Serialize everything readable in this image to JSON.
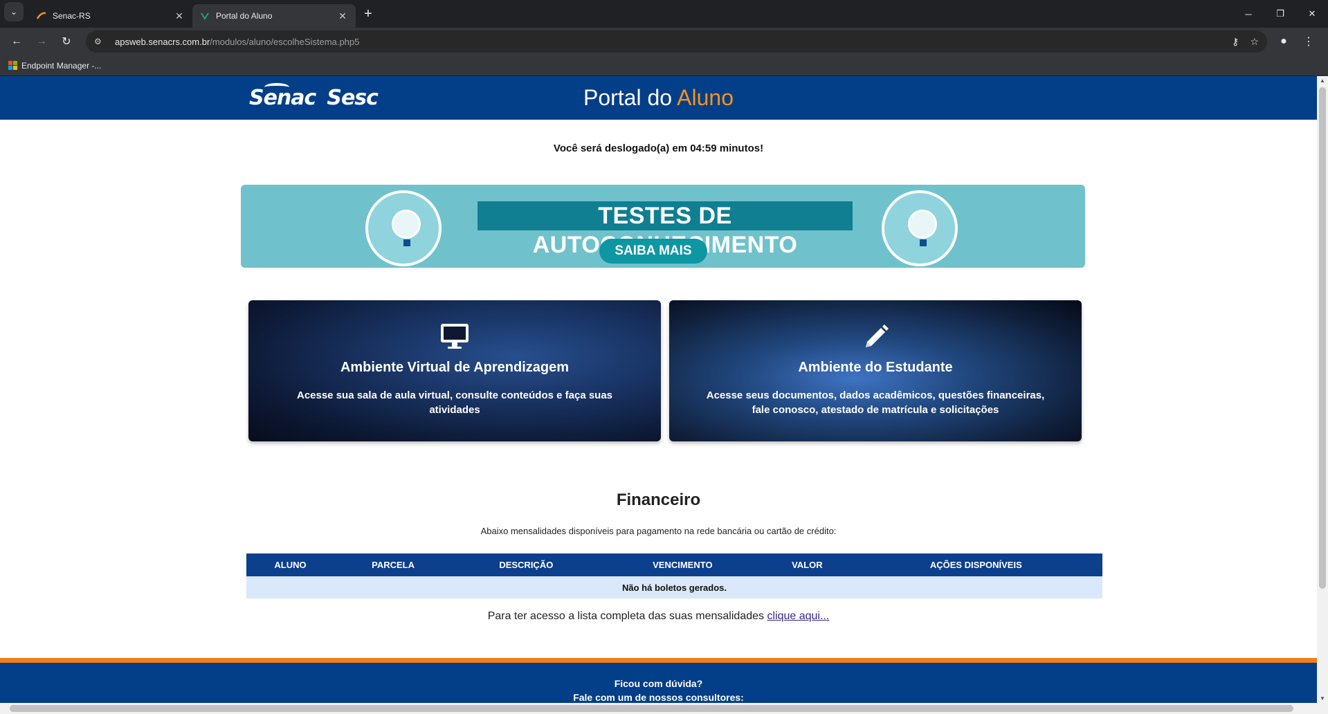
{
  "browser": {
    "tabs": [
      {
        "title": "Senac-RS",
        "active": false
      },
      {
        "title": "Portal do Aluno",
        "active": true
      }
    ],
    "url_host": "apsweb.senacrs.com.br",
    "url_path": "/modulos/aluno/escolheSistema.php5",
    "bookmark": "Endpoint Manager -..."
  },
  "header": {
    "logo_senac": "Senac",
    "logo_sesc": "Sesc",
    "title_prefix": "Portal do",
    "title_accent": "Aluno",
    "accent_color": "#f7931e",
    "brand_color": "#033f88"
  },
  "logout_notice": "Você será deslogado(a) em 04:59 minutos!",
  "banner": {
    "title": "TESTES DE AUTOCONHECIMENTO",
    "button": "SAIBA MAIS"
  },
  "cards": [
    {
      "icon": "monitor-icon",
      "title": "Ambiente Virtual de Aprendizagem",
      "description": "Acesse sua sala de aula virtual, consulte conteúdos e faça suas atividades"
    },
    {
      "icon": "pencil-icon",
      "title": "Ambiente do Estudante",
      "description": "Acesse seus documentos, dados acadêmicos, questões financeiras, fale conosco, atestado de matrícula e solicitações"
    }
  ],
  "financeiro": {
    "title": "Financeiro",
    "subtitle": "Abaixo mensalidades disponíveis para pagamento na rede bancária ou cartão de crédito:",
    "columns": [
      "ALUNO",
      "PARCELA",
      "DESCRIÇÃO",
      "VENCIMENTO",
      "VALOR",
      "AÇÕES DISPONÍVEIS"
    ],
    "empty_message": "Não há boletos gerados.",
    "full_list_text": "Para ter acesso a lista completa das suas mensalidades",
    "full_list_link": "clique aqui..."
  },
  "footer": {
    "question": "Ficou com dúvida?",
    "subtext": "Fale com um de nossos consultores:"
  }
}
